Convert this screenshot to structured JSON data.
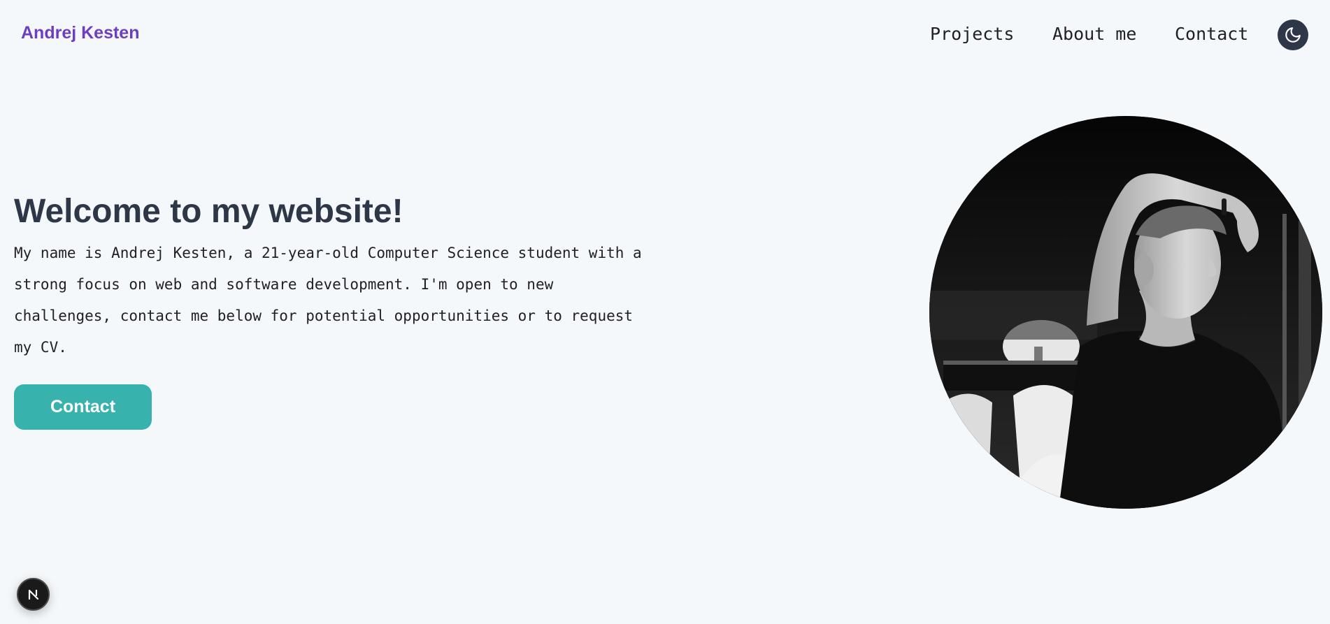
{
  "header": {
    "logo": "Andrej Kesten",
    "nav": {
      "projects": "Projects",
      "about": "About me",
      "contact": "Contact"
    },
    "theme_toggle_icon": "moon-icon"
  },
  "hero": {
    "title": "Welcome to my website!",
    "description_lines": [
      "My name is Andrej Kesten, a 21-year-old Computer Science student with a",
      "strong focus on web and software development. I'm open to new",
      "challenges, contact me below for potential opportunities or to request",
      "my CV."
    ],
    "cta_label": "Contact"
  },
  "portrait_icon": "profile-photo",
  "dev_badge_icon": "next-logo-icon",
  "colors": {
    "background": "#f5f8fb",
    "logo": "#6b3fbf",
    "heading": "#2d3748",
    "accent": "#38b2ac",
    "toggle": "#2d3748"
  }
}
